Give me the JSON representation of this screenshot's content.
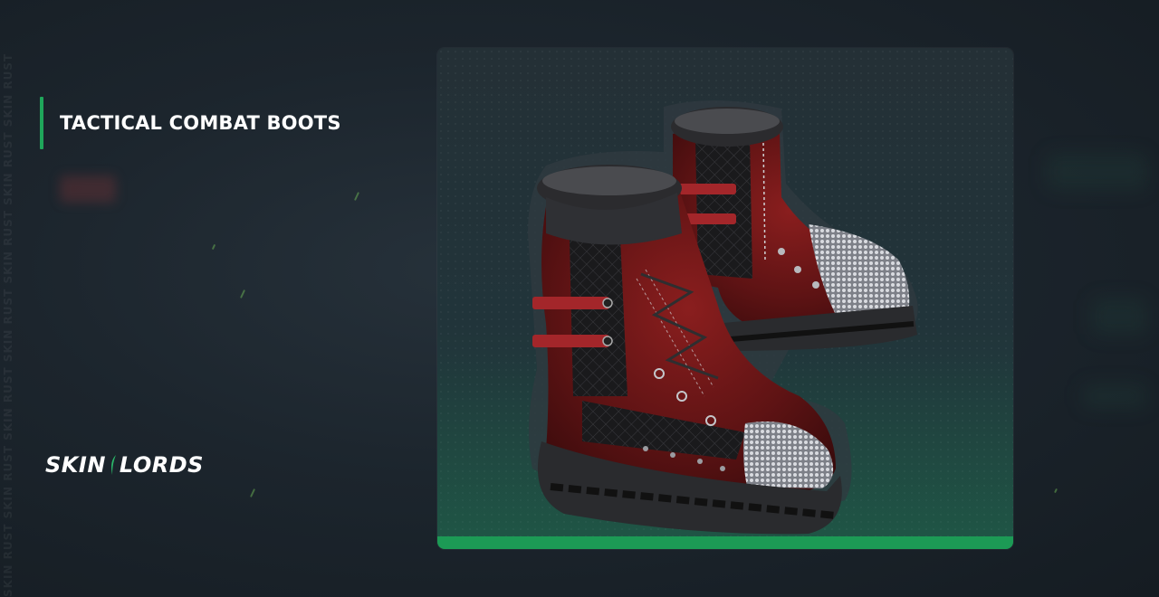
{
  "item": {
    "name": "TACTICAL COMBAT BOOTS"
  },
  "brand": {
    "logo_left": "SKIN",
    "logo_right": "LORDS",
    "watermark": "SKIN RUST SKIN RUST SKIN RUST SKIN RUST SKIN RUST SKIN RUST SKIN RUST"
  },
  "colors": {
    "accent": "#1fa65a",
    "footer_bar": "#1c9a55",
    "background": "#1c252d",
    "card": "#243036"
  },
  "icons": {
    "preview": "combat-boots-image",
    "logo_mark": "leaf-blade-icon"
  }
}
